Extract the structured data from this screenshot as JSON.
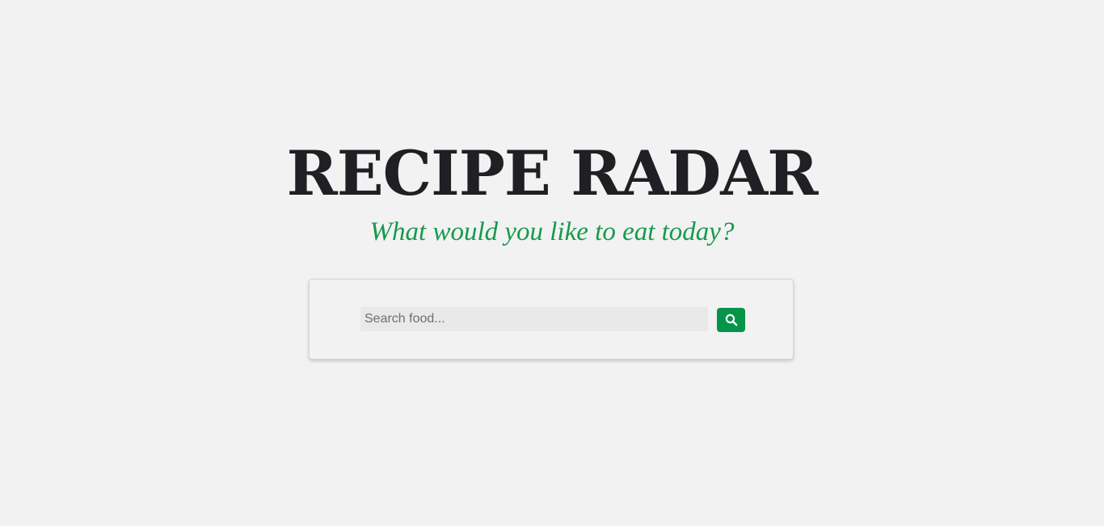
{
  "header": {
    "title": "RECIPE RADAR",
    "subtitle": "What would you like to eat today?"
  },
  "search": {
    "placeholder": "Search food...",
    "value": "",
    "button_icon": "search-icon"
  },
  "colors": {
    "background": "#f2f2f2",
    "title": "#1f1f24",
    "accent": "#169a4c",
    "button": "#06934a"
  }
}
